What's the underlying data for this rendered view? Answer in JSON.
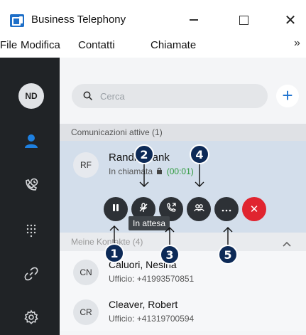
{
  "window": {
    "title": "Business Telephony",
    "close_glyph": "✕"
  },
  "menu": {
    "file": "File",
    "modifica": "Modifica",
    "contatti": "Contatti",
    "chiamate": "Chiamate",
    "more": "»"
  },
  "sidebar": {
    "user_initials": "ND",
    "icons": [
      "person-icon",
      "call-history-icon",
      "dialpad-icon",
      "link-icon",
      "gear-icon"
    ],
    "active_color": "#1e80e0"
  },
  "search": {
    "placeholder": "Cerca",
    "add_label": "+"
  },
  "active_section": {
    "title": "Comunicazioni attive (1)",
    "call": {
      "initials": "RF",
      "name": "Randi, Frank",
      "status": "In chiamata",
      "timer": "(00:01)",
      "tooltip": "In attesa",
      "hangup_glyph": "✕"
    }
  },
  "contacts_section": {
    "title": "Meine Kontakte (4)",
    "items": [
      {
        "initials": "CN",
        "name": "Caluori, Nesina",
        "phone": "Ufficio: +41993570851"
      },
      {
        "initials": "CR",
        "name": "Cleaver, Robert",
        "phone": "Ufficio: +41319700594"
      }
    ]
  },
  "callouts": [
    "1",
    "2",
    "3",
    "4",
    "5"
  ],
  "colors": {
    "accent": "#1e73d0",
    "callout": "#0d2a57",
    "hangup": "#e0242f",
    "timer": "#2e9a3d"
  }
}
